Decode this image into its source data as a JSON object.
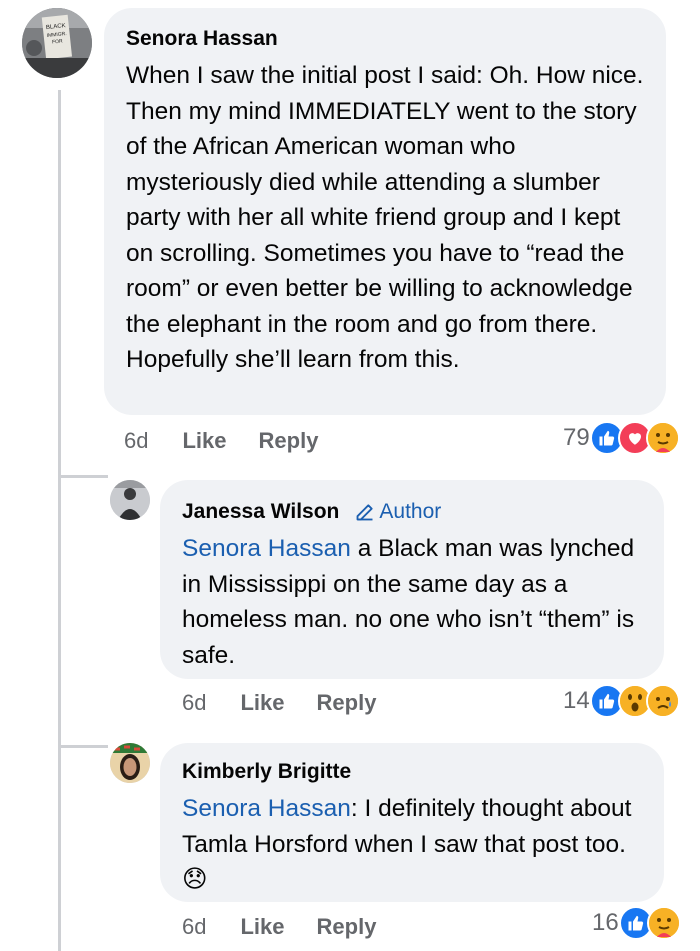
{
  "comments": [
    {
      "name": "Senora Hassan",
      "text": "When I saw the initial post I said: Oh. How nice. Then my mind IMMEDIATELY went to the story of the African American woman who mysteriously died while attending a slumber party with her all white friend group and I kept on scrolling. Sometimes you have to “read the room” or even better be willing to acknowledge the elephant in the room and go from there. Hopefully she’ll learn from this.",
      "time": "6d",
      "like_label": "Like",
      "reply_label": "Reply",
      "reaction_count": "79",
      "reaction_icons": [
        "like-icon",
        "love-icon",
        "care-icon"
      ]
    },
    {
      "name": "Janessa Wilson",
      "badge": "Author",
      "mention": "Senora Hassan",
      "text": " a Black man was lynched in Mississippi on the same day as a homeless man. no one who isn’t “them” is safe.",
      "time": "6d",
      "like_label": "Like",
      "reply_label": "Reply",
      "reaction_count": "14",
      "reaction_icons": [
        "like-icon",
        "wow-icon",
        "sad-icon"
      ]
    },
    {
      "name": "Kimberly Brigitte",
      "mention": "Senora Hassan",
      "text": ": I definitely thought about Tamla Horsford when I saw that post too. ",
      "emoji": "😞",
      "time": "6d",
      "like_label": "Like",
      "reply_label": "Reply",
      "reaction_count": "16",
      "reaction_icons": [
        "like-icon",
        "care-icon"
      ]
    }
  ],
  "avatar_sign_text": "BLACK IMMIGRANTS FOR JUSTICE",
  "colors": {
    "bubble": "#f0f2f5",
    "mention": "#1b5fb0",
    "meta": "#65676b",
    "like_blue": "#1877f2",
    "love_red": "#f33e58",
    "yellow": "#f7b125"
  }
}
